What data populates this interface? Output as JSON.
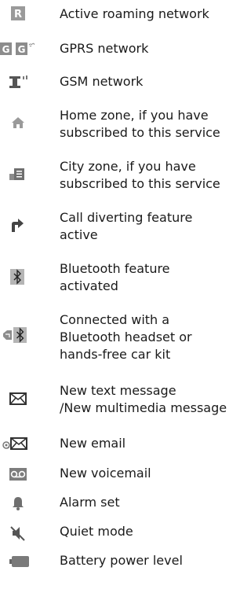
{
  "items": [
    {
      "icon": "roaming-icon",
      "label": "Active roaming network"
    },
    {
      "icon": "gprs-icon",
      "label": "GPRS network"
    },
    {
      "icon": "gsm-icon",
      "label": "GSM network"
    },
    {
      "icon": "home-zone-icon",
      "label": "Home zone, if you have\nsubscribed to this service"
    },
    {
      "icon": "city-zone-icon",
      "label": "City zone, if you have\nsubscribed to this service"
    },
    {
      "icon": "call-divert-icon",
      "label": "Call diverting feature\nactive"
    },
    {
      "icon": "bluetooth-icon",
      "label": "Bluetooth feature\nactivated"
    },
    {
      "icon": "bluetooth-headset-icon",
      "label": "Connected with a\nBluetooth headset or\nhands-free car kit"
    },
    {
      "icon": "message-icon",
      "label": "New text message\n/New multimedia message"
    },
    {
      "icon": "email-icon",
      "label": "New email"
    },
    {
      "icon": "voicemail-icon",
      "label": "New voicemail"
    },
    {
      "icon": "alarm-icon",
      "label": "Alarm set"
    },
    {
      "icon": "quiet-mode-icon",
      "label": "Quiet mode"
    },
    {
      "icon": "battery-icon",
      "label": "Battery power level"
    }
  ]
}
